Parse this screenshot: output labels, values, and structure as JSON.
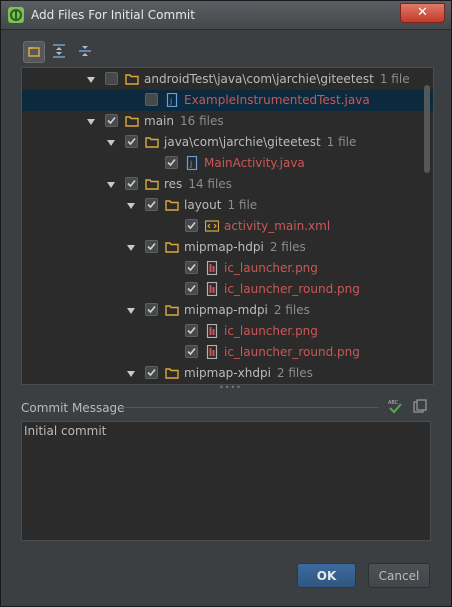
{
  "window": {
    "title": "Add Files For Initial Commit",
    "close_label": "✕"
  },
  "toolbar": {
    "buttons": [
      "group-by-directory-icon",
      "expand-all-icon",
      "collapse-all-icon"
    ]
  },
  "tree": [
    {
      "label": "androidTest\\java\\com\\jarchie\\giteetest",
      "count": "1 file",
      "kind": "folder",
      "checked": false
    },
    {
      "label": "ExampleInstrumentedTest.java",
      "count": "",
      "kind": "java",
      "checked": false
    },
    {
      "label": "main",
      "count": "16 files",
      "kind": "folder",
      "checked": true
    },
    {
      "label": "java\\com\\jarchie\\giteetest",
      "count": "1 file",
      "kind": "folder",
      "checked": true
    },
    {
      "label": "MainActivity.java",
      "count": "",
      "kind": "java",
      "checked": true
    },
    {
      "label": "res",
      "count": "14 files",
      "kind": "folder",
      "checked": true
    },
    {
      "label": "layout",
      "count": "1 file",
      "kind": "folder",
      "checked": true
    },
    {
      "label": "activity_main.xml",
      "count": "",
      "kind": "xml",
      "checked": true
    },
    {
      "label": "mipmap-hdpi",
      "count": "2 files",
      "kind": "folder",
      "checked": true
    },
    {
      "label": "ic_launcher.png",
      "count": "",
      "kind": "png",
      "checked": true
    },
    {
      "label": "ic_launcher_round.png",
      "count": "",
      "kind": "png",
      "checked": true
    },
    {
      "label": "mipmap-mdpi",
      "count": "2 files",
      "kind": "folder",
      "checked": true
    },
    {
      "label": "ic_launcher.png",
      "count": "",
      "kind": "png",
      "checked": true
    },
    {
      "label": "ic_launcher_round.png",
      "count": "",
      "kind": "png",
      "checked": true
    },
    {
      "label": "mipmap-xhdpi",
      "count": "2 files",
      "kind": "folder",
      "checked": true
    }
  ],
  "commit": {
    "label": "Commit Message",
    "text": "Initial commit"
  },
  "buttons": {
    "ok": "OK",
    "cancel": "Cancel"
  },
  "colors": {
    "accent": "#3c6aa0",
    "file_new": "#cc5656",
    "selection": "#0d293e",
    "folder": "#d9a83e"
  }
}
